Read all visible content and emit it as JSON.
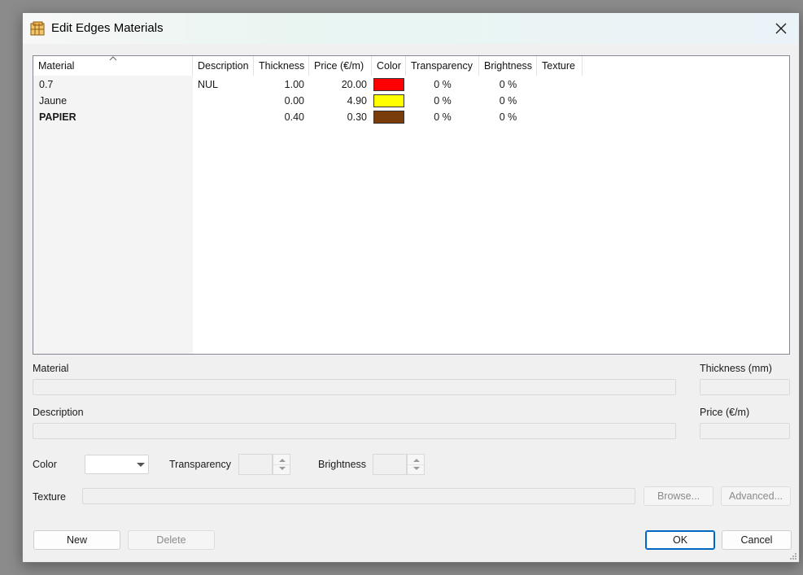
{
  "window": {
    "title": "Edit Edges Materials"
  },
  "table": {
    "columns": [
      "Material",
      "Description",
      "Thickness",
      "Price (€/m)",
      "Color",
      "Transparency",
      "Brightness",
      "Texture"
    ],
    "rows": [
      {
        "material": "0.7",
        "description": "NUL",
        "thickness": "1.00",
        "price": "20.00",
        "color": "#ff0000",
        "transparency": "0 %",
        "brightness": "0 %",
        "texture": "",
        "bold": false
      },
      {
        "material": "Jaune",
        "description": "",
        "thickness": "0.00",
        "price": "4.90",
        "color": "#ffff00",
        "transparency": "0 %",
        "brightness": "0 %",
        "texture": "",
        "bold": false
      },
      {
        "material": "PAPIER",
        "description": "",
        "thickness": "0.40",
        "price": "0.30",
        "color": "#7a3c0a",
        "transparency": "0 %",
        "brightness": "0 %",
        "texture": "",
        "bold": true
      }
    ]
  },
  "form": {
    "material_label": "Material",
    "thickness_label": "Thickness (mm)",
    "description_label": "Description",
    "price_label": "Price (€/m)",
    "color_label": "Color",
    "transparency_label": "Transparency",
    "brightness_label": "Brightness",
    "texture_label": "Texture",
    "browse_label": "Browse...",
    "advanced_label": "Advanced..."
  },
  "buttons": {
    "new": "New",
    "delete": "Delete",
    "ok": "OK",
    "cancel": "Cancel"
  },
  "icons": {
    "app": "materials-icon",
    "close": "close-icon",
    "sort": "sort-ascending-icon",
    "dropdown": "chevron-down-icon",
    "grip": "resize-grip-icon"
  }
}
